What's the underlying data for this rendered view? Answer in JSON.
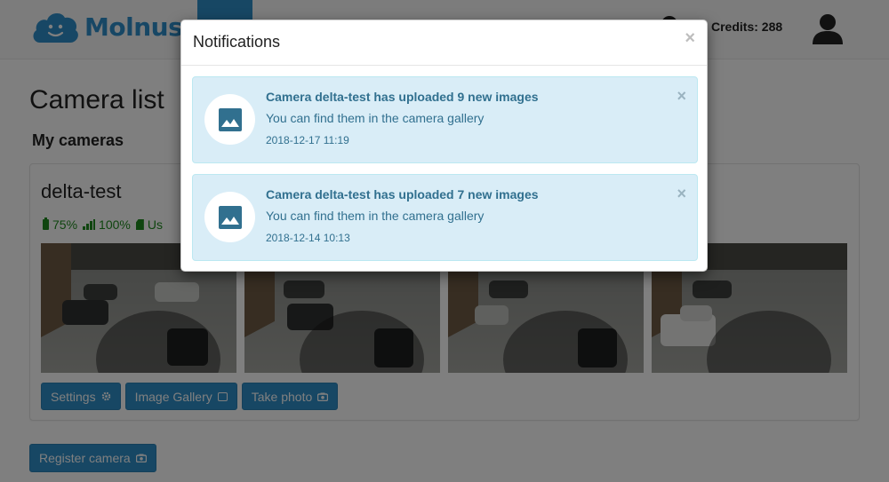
{
  "brand": {
    "name": "Molnus"
  },
  "header": {
    "credits_label": "Credits: 288"
  },
  "page": {
    "title": "Camera list",
    "section_title": "My cameras"
  },
  "camera": {
    "name": "delta-test",
    "battery": "75%",
    "signal": "100%",
    "storage_partial": "Us",
    "actions": {
      "settings": "Settings",
      "gallery": "Image Gallery",
      "take_photo": "Take photo"
    }
  },
  "register_label": "Register camera",
  "modal": {
    "title": "Notifications",
    "close_symbol": "×",
    "notifications": [
      {
        "title": "Camera delta-test has uploaded 9 new images",
        "body": "You can find them in the camera gallery",
        "time": "2018-12-17 11:19",
        "close_symbol": "×"
      },
      {
        "title": "Camera delta-test has uploaded 7 new images",
        "body": "You can find them in the camera gallery",
        "time": "2018-12-14 10:13",
        "close_symbol": "×"
      }
    ]
  },
  "icons": {
    "logo": "cloud-logo-icon",
    "user": "user-icon",
    "battery": "battery-icon",
    "signal": "signal-icon",
    "storage": "sd-card-icon",
    "settings": "gear-icon",
    "gallery": "images-icon",
    "camera": "camera-icon",
    "notification": "image-icon"
  },
  "colors": {
    "primary": "#2e8fc9",
    "brand": "#2f8fcb",
    "success": "#1e8a1e",
    "info_bg": "#d9edf7",
    "info_text": "#31708f"
  }
}
